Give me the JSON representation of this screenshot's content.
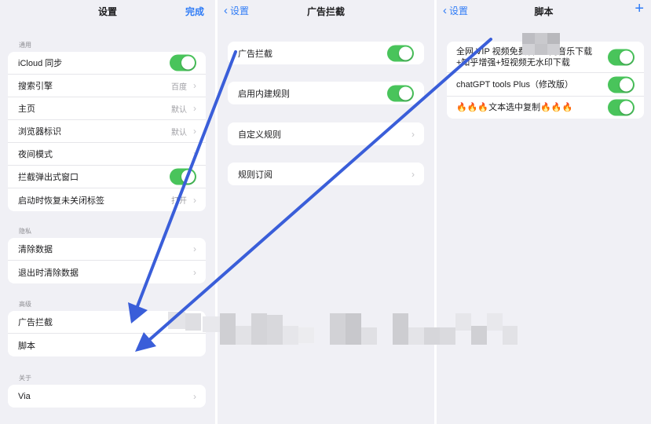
{
  "settings": {
    "title": "设置",
    "done": "完成",
    "general": {
      "header": "通用",
      "items": [
        {
          "label": "iCloud 同步",
          "toggle": true
        },
        {
          "label": "搜索引擎",
          "value": "百度"
        },
        {
          "label": "主页",
          "value": "默认"
        },
        {
          "label": "浏览器标识",
          "value": "默认"
        },
        {
          "label": "夜间模式",
          "value": ""
        },
        {
          "label": "拦截弹出式窗口",
          "toggle": true
        },
        {
          "label": "启动时恢复未关闭标签",
          "value": "打开"
        }
      ]
    },
    "privacy": {
      "header": "隐私",
      "items": [
        {
          "label": "清除数据"
        },
        {
          "label": "退出时清除数据"
        }
      ]
    },
    "advanced": {
      "header": "高级",
      "items": [
        {
          "label": "广告拦截"
        },
        {
          "label": "脚本"
        }
      ]
    },
    "about": {
      "header": "关于",
      "items": [
        {
          "label": "Via"
        }
      ]
    }
  },
  "adblock": {
    "back": "设置",
    "title": "广告拦截",
    "items": [
      {
        "label": "广告拦截",
        "toggle": true
      },
      {
        "label": "启用内建规则",
        "toggle": true
      },
      {
        "label": "自定义规则"
      },
      {
        "label": "规则订阅"
      }
    ]
  },
  "scripts": {
    "back": "设置",
    "title": "脚本",
    "add": "+",
    "items": [
      {
        "label": "全网 VIP 视频免费看+全网音乐下载+知乎增强+短视频无水印下载",
        "enabled": true
      },
      {
        "label": "chatGPT tools Plus（修改版）",
        "enabled": true
      },
      {
        "label": "🔥🔥🔥文本选中复制🔥🔥🔥",
        "enabled": true
      }
    ]
  },
  "colors": {
    "accent": "#2f7cf6",
    "toggle_on": "#49c45b",
    "arrow": "#3a5ed9",
    "background": "#f0f0f5"
  }
}
